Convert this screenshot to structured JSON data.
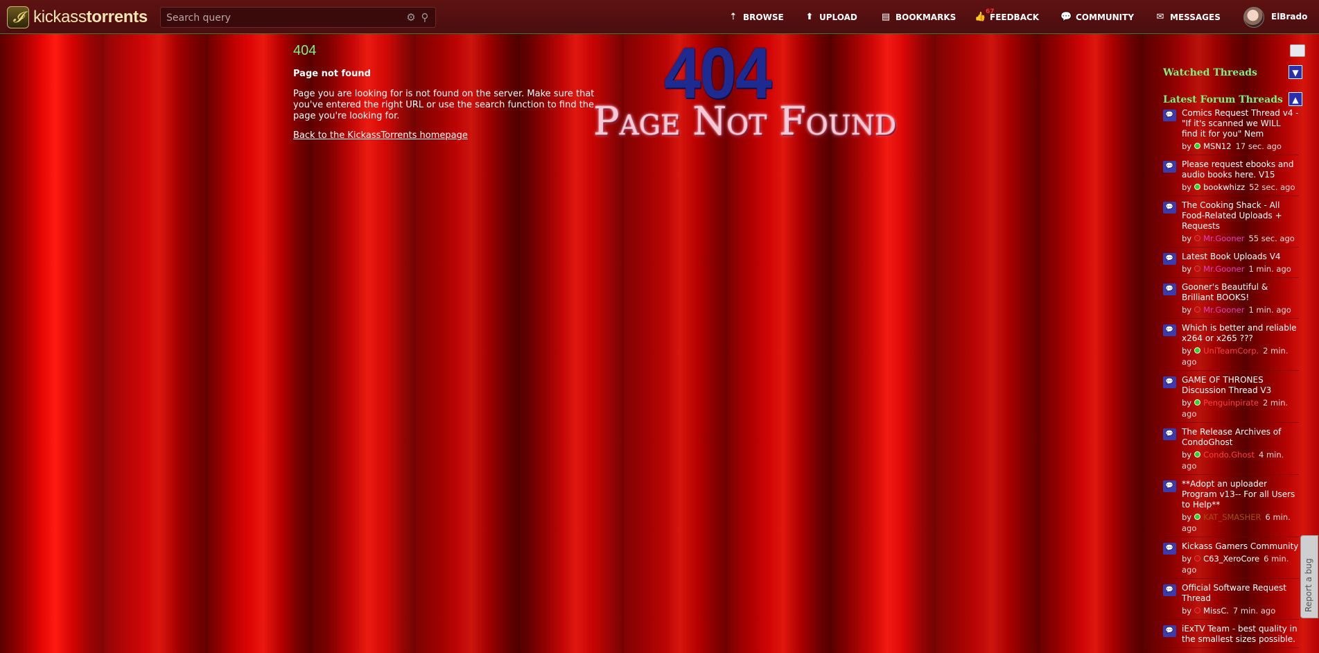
{
  "header": {
    "logo_text_light": "kickass",
    "logo_text_bold": "torrents",
    "logo_glyph": "𝓘",
    "search_placeholder": "Search query",
    "nav": [
      {
        "label": "BROWSE",
        "icon": "browse-icon"
      },
      {
        "label": "UPLOAD",
        "icon": "upload-icon"
      },
      {
        "label": "BOOKMARKS",
        "icon": "bookmark-icon"
      },
      {
        "label": "FEEDBACK",
        "icon": "thumbs-up-icon",
        "badge": "67"
      },
      {
        "label": "COMMUNITY",
        "icon": "chat-bubble-icon"
      },
      {
        "label": "MESSAGES",
        "icon": "envelope-icon"
      }
    ],
    "username": "ElBrado"
  },
  "error": {
    "code": "404",
    "title": "Page not found",
    "description": "Page you are looking for is not found on the server. Make sure that you've entered the right URL or use the search function to find the page you're looking for.",
    "home_link": "Back to the KickassTorrents homepage",
    "banner_number": "404",
    "banner_text": "Page Not Found"
  },
  "sidebar": {
    "watched_heading": "Watched Threads",
    "latest_heading": "Latest Forum Threads",
    "threads": [
      {
        "title": "Comics Request Thread v4 - \"If it's scanned we WILL find it for you\" Nem",
        "by": "by",
        "user": "MSN12",
        "time": "17 sec. ago",
        "status": "online",
        "user_color": "white"
      },
      {
        "title": "Please request ebooks and audio books here. V15",
        "by": "by",
        "user": "bookwhizz",
        "time": "52 sec. ago",
        "status": "online",
        "user_color": "white"
      },
      {
        "title": "The Cooking Shack - All Food-Related Uploads + Requests",
        "by": "by",
        "user": "Mr.Gooner",
        "time": "55 sec. ago",
        "status": "offline",
        "user_color": "pink"
      },
      {
        "title": "Latest Book Uploads V4",
        "by": "by",
        "user": "Mr.Gooner",
        "time": "1 min. ago",
        "status": "offline",
        "user_color": "pink"
      },
      {
        "title": "Gooner's Beautiful & Brilliant BOOKS!",
        "by": "by",
        "user": "Mr.Gooner",
        "time": "1 min. ago",
        "status": "offline",
        "user_color": "pink"
      },
      {
        "title": "Which is better and reliable x264 or x265 ???",
        "by": "by",
        "user": "UniTeamCorp.",
        "time": "2 min. ago",
        "status": "online",
        "user_color": "red"
      },
      {
        "title": "GAME OF THRONES Discussion Thread V3",
        "by": "by",
        "user": "Penguinpirate",
        "time": "2 min. ago",
        "status": "online",
        "user_color": "red"
      },
      {
        "title": "The Release Archives of CondoGhost",
        "by": "by",
        "user": "Condo.Ghost",
        "time": "4 min. ago",
        "status": "online",
        "user_color": "red"
      },
      {
        "title": "**Adopt an uploader Program v13-- For all Users to Help**",
        "by": "by",
        "user": "KAT_SMASHER",
        "time": "6 min. ago",
        "status": "online",
        "user_color": "brown"
      },
      {
        "title": "Kickass Gamers Community",
        "by": "by",
        "user": "C63_XeroCore",
        "time": "6 min. ago",
        "status": "offline",
        "user_color": "white"
      },
      {
        "title": "Official Software Request Thread",
        "by": "by",
        "user": "MissC.",
        "time": "7 min. ago",
        "status": "offline",
        "user_color": "white"
      },
      {
        "title": "iExTV Team - best quality in the smallest sizes possible.",
        "by": "",
        "user": "",
        "time": "",
        "status": "none",
        "user_color": "white"
      }
    ]
  },
  "report_bug": "Report a bug",
  "colors": {
    "header_bg": "#4a0d0d",
    "accent_green": "#7cf27c",
    "thread_icon": "#3b3bb0",
    "banner_blue": "#1e2a90",
    "banner_pink": "#f5c8d6"
  }
}
